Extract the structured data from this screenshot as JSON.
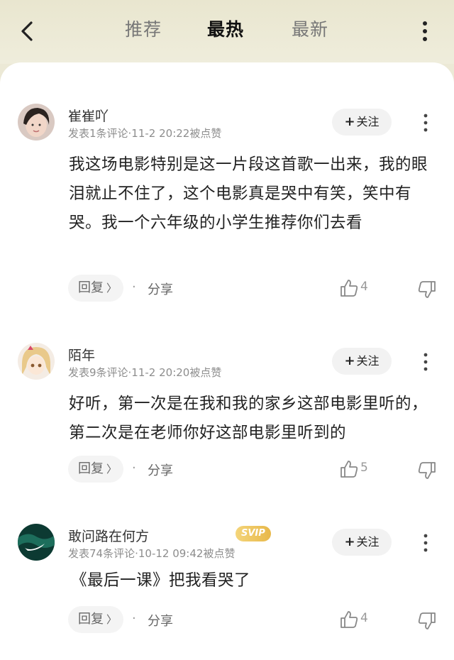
{
  "tabs": [
    {
      "label": "推荐"
    },
    {
      "label": "最热"
    },
    {
      "label": "最新"
    }
  ],
  "comments": [
    {
      "username": "崔崔吖",
      "meta": "发表1条评论·11-2 20:22被点赞",
      "follow_label": "关注",
      "text": "我这场电影特别是这一片段这首歌一出来，我的眼泪就止不住了，这个电影真是哭中有笑，笑中有哭。我一个六年级的小学生推荐你们去看",
      "reply_label": "回复",
      "share_label": "分享",
      "likes": "4"
    },
    {
      "username": "陌年",
      "meta": "发表9条评论·11-2 20:20被点赞",
      "follow_label": "关注",
      "text": "好听，第一次是在我和我的家乡这部电影里听的，第二次是在老师你好这部电影里听到的",
      "reply_label": "回复",
      "share_label": "分享",
      "likes": "5"
    },
    {
      "username": "敢问路在何方",
      "badge": "SVIP",
      "meta": "发表74条评论·10-12 09:42被点赞",
      "follow_label": "关注",
      "text": "《最后一课》把我看哭了",
      "reply_label": "回复",
      "share_label": "分享",
      "likes": "4"
    }
  ],
  "colors": {
    "header_bg": "#ece9d6",
    "active_tab": "#111111",
    "inactive_tab": "#777777",
    "svip_badge": "#e8b84a"
  }
}
